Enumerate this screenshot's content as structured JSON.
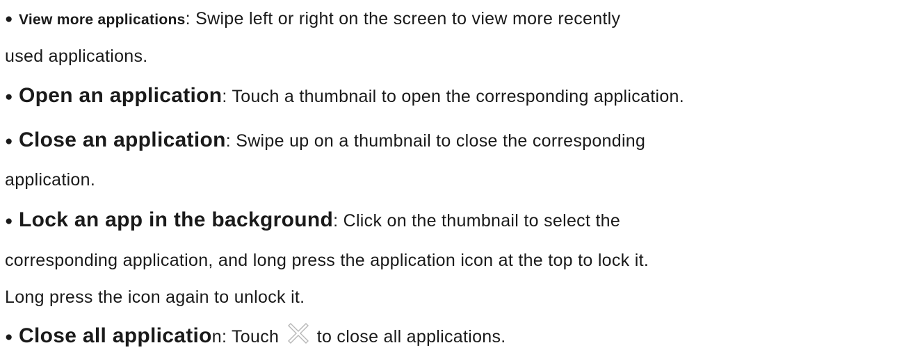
{
  "items": [
    {
      "term": "View more applications",
      "desc_line1": ": Swipe left or right on the screen to view more recently",
      "desc_line2": "used applications."
    },
    {
      "term": "Open an application",
      "desc_line1": ": Touch a thumbnail to open the corresponding application."
    },
    {
      "term": "Close an application",
      "desc_line1": ": Swipe up on a thumbnail to close the corresponding",
      "desc_line2": "application."
    },
    {
      "term": "Lock an app in the background",
      "desc_line1": ": Click on the thumbnail to select the",
      "desc_line2": "corresponding application, and long press the application icon at the top to lock it.",
      "desc_line3": "Long press the icon again to unlock it."
    },
    {
      "term": "Close all applicatio",
      "term_tail": "n",
      "desc_before_icon": ": Touch ",
      "icon": "close-x-icon",
      "desc_after_icon": " to close all applications."
    }
  ],
  "bullet": "●",
  "colors": {
    "text": "#1a1a1a",
    "icon_stroke": "#b8b8b8",
    "background": "#ffffff"
  }
}
